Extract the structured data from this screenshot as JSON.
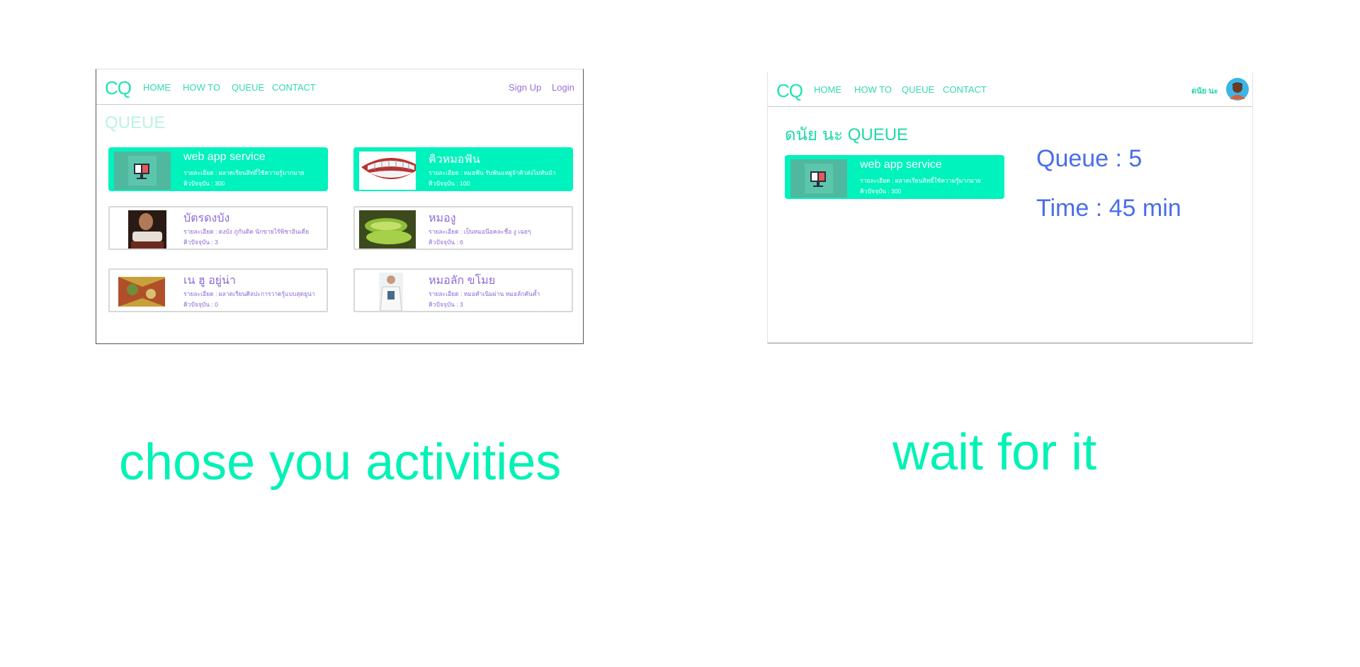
{
  "colors": {
    "accent": "#00f2bd",
    "logo": "#1fe3b1",
    "link_purple": "#9b6fd8",
    "stat_blue": "#4a6ee8"
  },
  "left_screen": {
    "nav": {
      "logo": "CQ",
      "links": [
        "HOME",
        "HOW TO",
        "QUEUE",
        "CONTACT"
      ],
      "signup": "Sign Up",
      "login": "Login"
    },
    "title": "QUEUE",
    "cards": [
      {
        "title": "web app service",
        "detail": "รายละเอียด : ผลาดเรียนสิทธิ์ใช้ความรู้มากมาย",
        "queue": "คิวปัจจุบัน : 300",
        "image": "computer-service-image"
      },
      {
        "title": "คิวหมอฟัน",
        "detail": "รายละเอียด : หมอฟัน รับฟันแหยู่จ้าคิวส่งไม่ทันนำ",
        "queue": "คิวปัจจุบัน : 100",
        "image": "teeth-image"
      },
      {
        "title": "บัตรดงบัง",
        "detail": "รายละเอียด : ดงบัง ภูกันดิด นักขายไร้พิชาอินเดีย",
        "queue": "คิวปัจจุบัน : 3",
        "image": "portrait-image"
      },
      {
        "title": "หมองู",
        "detail": "รายละเอียด : เป็นหมอนีอคละชื่อ งู เฉยๆ",
        "queue": "คิวปัจจุบัน : 6",
        "image": "snake-image"
      },
      {
        "title": "เน ฮู อยู่น่า",
        "detail": "รายละเอียด : ผลาดเรียนศิลปะการวาดรู้แบบสุดยูน่า",
        "queue": "คิวปัจจุบัน : 0",
        "image": "painting-image"
      },
      {
        "title": "หมอลัก ขโมย",
        "detail": "รายละเอียด : หมอคำเนิมผ่าน หมอลักคันค้ำ",
        "queue": "คิวปัจจุบัน : 3",
        "image": "doctor-image"
      }
    ]
  },
  "right_screen": {
    "nav": {
      "logo": "CQ",
      "links": [
        "HOME",
        "HOW TO",
        "QUEUE",
        "CONTACT"
      ],
      "username": "ดนัย นะ"
    },
    "title": "ดนัย นะ QUEUE",
    "card": {
      "title": "web app service",
      "detail": "รายละเอียด : ผลาดเรียนสิทธิ์ใช้ความรู้มากมาย",
      "queue": "คิวปัจจุบัน : 300",
      "image": "computer-service-image"
    },
    "queue_label": "Queue : 5",
    "time_label": "Time : 45 min"
  },
  "captions": {
    "left": "chose you activities",
    "right": "wait for it"
  }
}
